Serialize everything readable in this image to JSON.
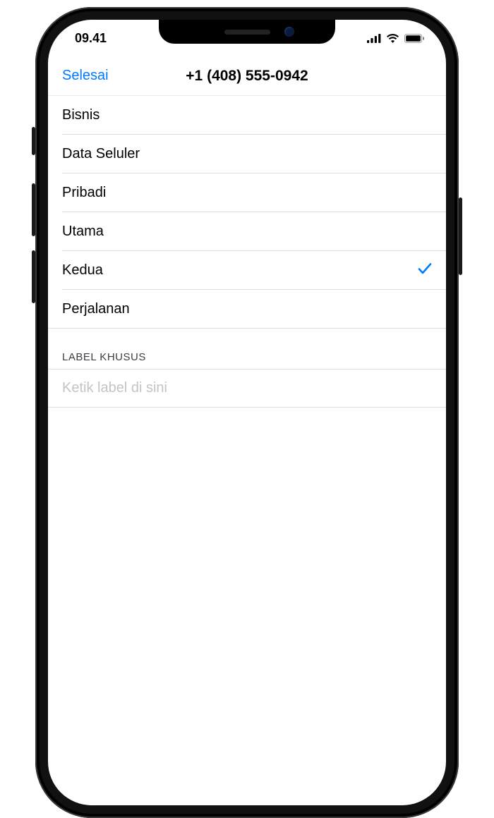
{
  "status": {
    "time": "09.41"
  },
  "nav": {
    "done_label": "Selesai",
    "title": "+1 (408) 555-0942"
  },
  "labels": [
    {
      "text": "Bisnis",
      "selected": false
    },
    {
      "text": "Data Seluler",
      "selected": false
    },
    {
      "text": "Pribadi",
      "selected": false
    },
    {
      "text": "Utama",
      "selected": false
    },
    {
      "text": "Kedua",
      "selected": true
    },
    {
      "text": "Perjalanan",
      "selected": false
    }
  ],
  "custom_section": {
    "header": "LABEL KHUSUS",
    "placeholder": "Ketik label di sini"
  }
}
